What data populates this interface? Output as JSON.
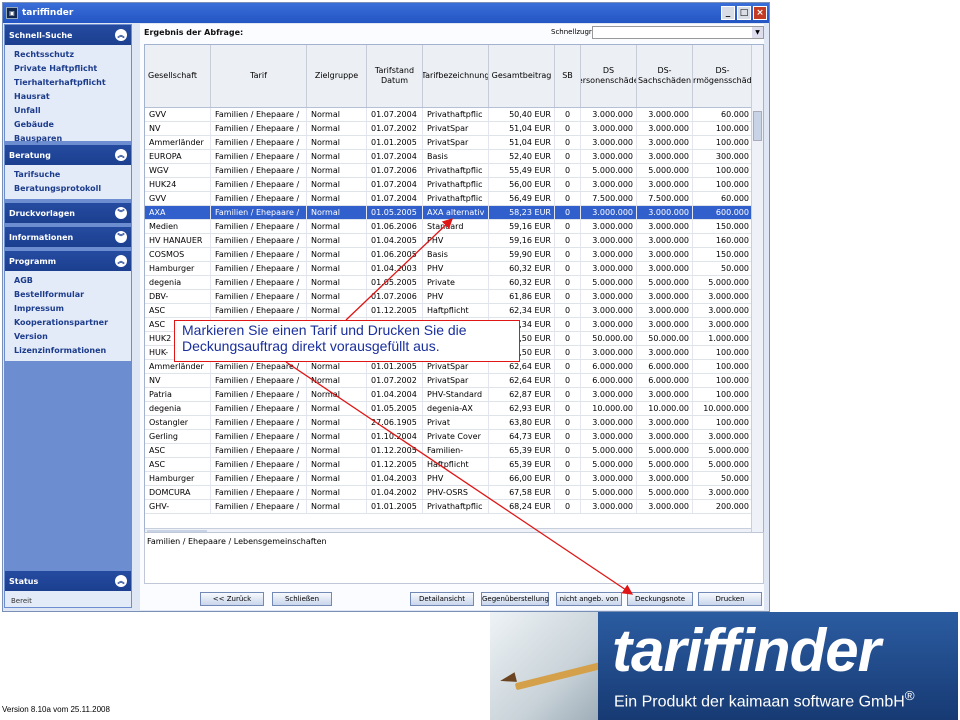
{
  "window": {
    "title": "tariffinder",
    "buttons": {
      "minimize": "_",
      "maximize": "□",
      "close": "×"
    }
  },
  "sidebar": {
    "sections": [
      {
        "title": "Schnell-Suche",
        "items": [
          "Rechtsschutz",
          "Private Haftpflicht",
          "Tierhalterhaftpflicht",
          "Hausrat",
          "Unfall",
          "Gebäude",
          "Bausparen"
        ]
      },
      {
        "title": "Beratung",
        "items": [
          "Tarifsuche",
          "Beratungsprotokoll"
        ]
      },
      {
        "title": "Druckvorlagen",
        "items": []
      },
      {
        "title": "Informationen",
        "items": []
      },
      {
        "title": "Programm",
        "items": [
          "AGB",
          "Bestellformular",
          "Impressum",
          "Kooperationspartner",
          "Version",
          "Lizenzinformationen"
        ]
      },
      {
        "title": "Status",
        "items": [
          "Bereit"
        ]
      }
    ]
  },
  "main": {
    "heading": "Ergebnis der Abfrage:",
    "quickaccess_label": "Schnellzugriff:",
    "quickaccess_value": ""
  },
  "table": {
    "headers": [
      "Gesellschaft",
      "Tarif",
      "Zielgruppe",
      "Tarifstand Datum",
      "Tarifbezeichnung",
      "Gesamtbeitrag",
      "SB",
      "DS Personenschäden",
      "DS-Sachschäden",
      "DS-Vermögensschäden"
    ],
    "selected_index": 7,
    "rows": [
      [
        "GVV",
        "Familien / Ehepaare /",
        "Normal",
        "01.07.2004",
        "Privathaftpflic",
        "50,40 EUR",
        "0",
        "3.000.000",
        "3.000.000",
        "60.000"
      ],
      [
        "NV",
        "Familien / Ehepaare /",
        "Normal",
        "01.07.2002",
        "PrivatSpar",
        "51,04 EUR",
        "0",
        "3.000.000",
        "3.000.000",
        "100.000"
      ],
      [
        "Ammerländer",
        "Familien / Ehepaare /",
        "Normal",
        "01.01.2005",
        "PrivatSpar",
        "51,04 EUR",
        "0",
        "3.000.000",
        "3.000.000",
        "100.000"
      ],
      [
        "EUROPA",
        "Familien / Ehepaare /",
        "Normal",
        "01.07.2004",
        "Basis",
        "52,40 EUR",
        "0",
        "3.000.000",
        "3.000.000",
        "300.000"
      ],
      [
        "WGV",
        "Familien / Ehepaare /",
        "Normal",
        "01.07.2006",
        "Privathaftpflic",
        "55,49 EUR",
        "0",
        "5.000.000",
        "5.000.000",
        "100.000"
      ],
      [
        "HUK24",
        "Familien / Ehepaare /",
        "Normal",
        "01.07.2004",
        "Privathaftpflic",
        "56,00 EUR",
        "0",
        "3.000.000",
        "3.000.000",
        "100.000"
      ],
      [
        "GVV",
        "Familien / Ehepaare /",
        "Normal",
        "01.07.2004",
        "Privathaftpflic",
        "56,49 EUR",
        "0",
        "7.500.000",
        "7.500.000",
        "60.000"
      ],
      [
        "AXA",
        "Familien / Ehepaare /",
        "Normal",
        "01.05.2005",
        "AXA alternativ",
        "58,23 EUR",
        "0",
        "3.000.000",
        "3.000.000",
        "600.000"
      ],
      [
        "Medien",
        "Familien / Ehepaare /",
        "Normal",
        "01.06.2006",
        "Standard",
        "59,16 EUR",
        "0",
        "3.000.000",
        "3.000.000",
        "150.000"
      ],
      [
        "HV HANAUER",
        "Familien / Ehepaare /",
        "Normal",
        "01.04.2005",
        "PHV",
        "59,16 EUR",
        "0",
        "3.000.000",
        "3.000.000",
        "160.000"
      ],
      [
        "COSMOS",
        "Familien / Ehepaare /",
        "Normal",
        "01.06.2005",
        "Basis",
        "59,90 EUR",
        "0",
        "3.000.000",
        "3.000.000",
        "150.000"
      ],
      [
        "Hamburger",
        "Familien / Ehepaare /",
        "Normal",
        "01.04.2003",
        "PHV",
        "60,32 EUR",
        "0",
        "3.000.000",
        "3.000.000",
        "50.000"
      ],
      [
        "degenia",
        "Familien / Ehepaare /",
        "Normal",
        "01.05.2005",
        "Private",
        "60,32 EUR",
        "0",
        "5.000.000",
        "5.000.000",
        "5.000.000"
      ],
      [
        "DBV-",
        "Familien / Ehepaare /",
        "Normal",
        "01.07.2006",
        "PHV",
        "61,86 EUR",
        "0",
        "3.000.000",
        "3.000.000",
        "3.000.000"
      ],
      [
        "ASC",
        "Familien / Ehepaare /",
        "Normal",
        "01.12.2005",
        "Haftpflicht",
        "62,34 EUR",
        "0",
        "3.000.000",
        "3.000.000",
        "3.000.000"
      ],
      [
        "ASC",
        "Familien / Ehepaare /",
        "Normal",
        "",
        "",
        "62,34 EUR",
        "0",
        "3.000.000",
        "3.000.000",
        "3.000.000"
      ],
      [
        "HUK2",
        "Familien / Ehepaare /",
        "Normal",
        "",
        "",
        "62,50 EUR",
        "0",
        "50.000.00",
        "50.000.00",
        "1.000.000"
      ],
      [
        "HUK-",
        "Familien / Ehepaare /",
        "Normal",
        "",
        "",
        "62,50 EUR",
        "0",
        "3.000.000",
        "3.000.000",
        "100.000"
      ],
      [
        "Ammerländer",
        "Familien / Ehepaare /",
        "Normal",
        "01.01.2005",
        "PrivatSpar",
        "62,64 EUR",
        "0",
        "6.000.000",
        "6.000.000",
        "100.000"
      ],
      [
        "NV",
        "Familien / Ehepaare /",
        "Normal",
        "01.07.2002",
        "PrivatSpar",
        "62,64 EUR",
        "0",
        "6.000.000",
        "6.000.000",
        "100.000"
      ],
      [
        "Patria",
        "Familien / Ehepaare /",
        "Normal",
        "01.04.2004",
        "PHV-Standard",
        "62,87 EUR",
        "0",
        "3.000.000",
        "3.000.000",
        "100.000"
      ],
      [
        "degenia",
        "Familien / Ehepaare /",
        "Normal",
        "01.05.2005",
        "degenia-AX",
        "62,93 EUR",
        "0",
        "10.000.00",
        "10.000.00",
        "10.000.000"
      ],
      [
        "Ostangler",
        "Familien / Ehepaare /",
        "Normal",
        "27.06.1905",
        "Privat",
        "63,80 EUR",
        "0",
        "3.000.000",
        "3.000.000",
        "100.000"
      ],
      [
        "Gerling",
        "Familien / Ehepaare /",
        "Normal",
        "01.10.2004",
        "Private Cover",
        "64,73 EUR",
        "0",
        "3.000.000",
        "3.000.000",
        "3.000.000"
      ],
      [
        "ASC",
        "Familien / Ehepaare /",
        "Normal",
        "01.12.2005",
        "Familien-",
        "65,39 EUR",
        "0",
        "5.000.000",
        "5.000.000",
        "5.000.000"
      ],
      [
        "ASC",
        "Familien / Ehepaare /",
        "Normal",
        "01.12.2005",
        "Haftpflicht",
        "65,39 EUR",
        "0",
        "5.000.000",
        "5.000.000",
        "5.000.000"
      ],
      [
        "Hamburger",
        "Familien / Ehepaare /",
        "Normal",
        "01.04.2003",
        "PHV",
        "66,00 EUR",
        "0",
        "3.000.000",
        "3.000.000",
        "50.000"
      ],
      [
        "DOMCURA",
        "Familien / Ehepaare /",
        "Normal",
        "01.04.2002",
        "PHV-OSRS",
        "67,58 EUR",
        "0",
        "5.000.000",
        "5.000.000",
        "3.000.000"
      ],
      [
        "GHV-",
        "Familien / Ehepaare /",
        "Normal",
        "01.01.2005",
        "Privathaftpflic",
        "68,24 EUR",
        "0",
        "3.000.000",
        "3.000.000",
        "200.000"
      ]
    ]
  },
  "detail": {
    "text": "Familien / Ehepaare / Lebensgemeinschaften"
  },
  "buttons": [
    "<< Zurück",
    "Schließen",
    "Detailansicht",
    "Gegenüberstellung",
    "nicht angeb. von",
    "Deckungsnote",
    "Drucken"
  ],
  "annotation": {
    "line1": "Markieren Sie einen Tarif und Drucken Sie die",
    "line2": "Deckungsauftrag direkt vorausgefüllt aus."
  },
  "brand": {
    "title": "tariffinder",
    "subtitle": "Ein Produkt der kaimaan software GmbH",
    "reg": "®"
  },
  "footer": {
    "version": "Version 8.10a vom 25.11.2008"
  },
  "colors": {
    "accent": "#315fcc",
    "annotation_border": "#e01515",
    "annotation_text": "#1a2f9c",
    "brand_blue": "#2b5ca1"
  }
}
